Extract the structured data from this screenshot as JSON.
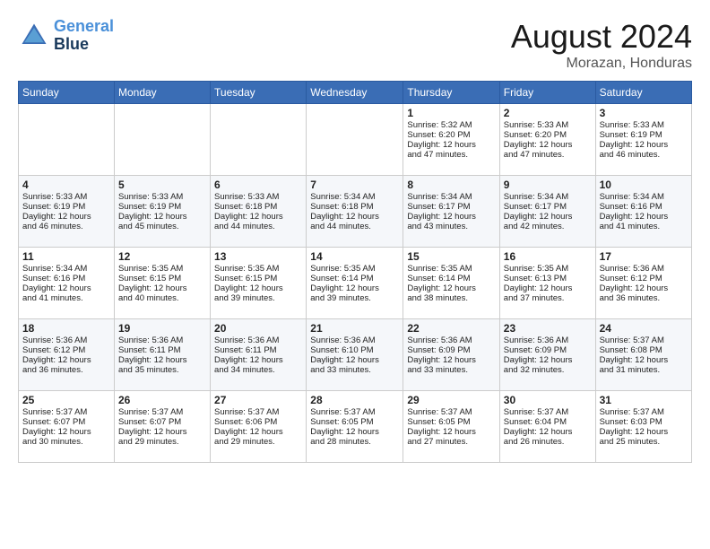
{
  "header": {
    "logo_line1": "General",
    "logo_line2": "Blue",
    "month_year": "August 2024",
    "location": "Morazan, Honduras"
  },
  "weekdays": [
    "Sunday",
    "Monday",
    "Tuesday",
    "Wednesday",
    "Thursday",
    "Friday",
    "Saturday"
  ],
  "weeks": [
    [
      {
        "day": "",
        "content": ""
      },
      {
        "day": "",
        "content": ""
      },
      {
        "day": "",
        "content": ""
      },
      {
        "day": "",
        "content": ""
      },
      {
        "day": "1",
        "content": "Sunrise: 5:32 AM\nSunset: 6:20 PM\nDaylight: 12 hours\nand 47 minutes."
      },
      {
        "day": "2",
        "content": "Sunrise: 5:33 AM\nSunset: 6:20 PM\nDaylight: 12 hours\nand 47 minutes."
      },
      {
        "day": "3",
        "content": "Sunrise: 5:33 AM\nSunset: 6:19 PM\nDaylight: 12 hours\nand 46 minutes."
      }
    ],
    [
      {
        "day": "4",
        "content": "Sunrise: 5:33 AM\nSunset: 6:19 PM\nDaylight: 12 hours\nand 46 minutes."
      },
      {
        "day": "5",
        "content": "Sunrise: 5:33 AM\nSunset: 6:19 PM\nDaylight: 12 hours\nand 45 minutes."
      },
      {
        "day": "6",
        "content": "Sunrise: 5:33 AM\nSunset: 6:18 PM\nDaylight: 12 hours\nand 44 minutes."
      },
      {
        "day": "7",
        "content": "Sunrise: 5:34 AM\nSunset: 6:18 PM\nDaylight: 12 hours\nand 44 minutes."
      },
      {
        "day": "8",
        "content": "Sunrise: 5:34 AM\nSunset: 6:17 PM\nDaylight: 12 hours\nand 43 minutes."
      },
      {
        "day": "9",
        "content": "Sunrise: 5:34 AM\nSunset: 6:17 PM\nDaylight: 12 hours\nand 42 minutes."
      },
      {
        "day": "10",
        "content": "Sunrise: 5:34 AM\nSunset: 6:16 PM\nDaylight: 12 hours\nand 41 minutes."
      }
    ],
    [
      {
        "day": "11",
        "content": "Sunrise: 5:34 AM\nSunset: 6:16 PM\nDaylight: 12 hours\nand 41 minutes."
      },
      {
        "day": "12",
        "content": "Sunrise: 5:35 AM\nSunset: 6:15 PM\nDaylight: 12 hours\nand 40 minutes."
      },
      {
        "day": "13",
        "content": "Sunrise: 5:35 AM\nSunset: 6:15 PM\nDaylight: 12 hours\nand 39 minutes."
      },
      {
        "day": "14",
        "content": "Sunrise: 5:35 AM\nSunset: 6:14 PM\nDaylight: 12 hours\nand 39 minutes."
      },
      {
        "day": "15",
        "content": "Sunrise: 5:35 AM\nSunset: 6:14 PM\nDaylight: 12 hours\nand 38 minutes."
      },
      {
        "day": "16",
        "content": "Sunrise: 5:35 AM\nSunset: 6:13 PM\nDaylight: 12 hours\nand 37 minutes."
      },
      {
        "day": "17",
        "content": "Sunrise: 5:36 AM\nSunset: 6:12 PM\nDaylight: 12 hours\nand 36 minutes."
      }
    ],
    [
      {
        "day": "18",
        "content": "Sunrise: 5:36 AM\nSunset: 6:12 PM\nDaylight: 12 hours\nand 36 minutes."
      },
      {
        "day": "19",
        "content": "Sunrise: 5:36 AM\nSunset: 6:11 PM\nDaylight: 12 hours\nand 35 minutes."
      },
      {
        "day": "20",
        "content": "Sunrise: 5:36 AM\nSunset: 6:11 PM\nDaylight: 12 hours\nand 34 minutes."
      },
      {
        "day": "21",
        "content": "Sunrise: 5:36 AM\nSunset: 6:10 PM\nDaylight: 12 hours\nand 33 minutes."
      },
      {
        "day": "22",
        "content": "Sunrise: 5:36 AM\nSunset: 6:09 PM\nDaylight: 12 hours\nand 33 minutes."
      },
      {
        "day": "23",
        "content": "Sunrise: 5:36 AM\nSunset: 6:09 PM\nDaylight: 12 hours\nand 32 minutes."
      },
      {
        "day": "24",
        "content": "Sunrise: 5:37 AM\nSunset: 6:08 PM\nDaylight: 12 hours\nand 31 minutes."
      }
    ],
    [
      {
        "day": "25",
        "content": "Sunrise: 5:37 AM\nSunset: 6:07 PM\nDaylight: 12 hours\nand 30 minutes."
      },
      {
        "day": "26",
        "content": "Sunrise: 5:37 AM\nSunset: 6:07 PM\nDaylight: 12 hours\nand 29 minutes."
      },
      {
        "day": "27",
        "content": "Sunrise: 5:37 AM\nSunset: 6:06 PM\nDaylight: 12 hours\nand 29 minutes."
      },
      {
        "day": "28",
        "content": "Sunrise: 5:37 AM\nSunset: 6:05 PM\nDaylight: 12 hours\nand 28 minutes."
      },
      {
        "day": "29",
        "content": "Sunrise: 5:37 AM\nSunset: 6:05 PM\nDaylight: 12 hours\nand 27 minutes."
      },
      {
        "day": "30",
        "content": "Sunrise: 5:37 AM\nSunset: 6:04 PM\nDaylight: 12 hours\nand 26 minutes."
      },
      {
        "day": "31",
        "content": "Sunrise: 5:37 AM\nSunset: 6:03 PM\nDaylight: 12 hours\nand 25 minutes."
      }
    ]
  ]
}
